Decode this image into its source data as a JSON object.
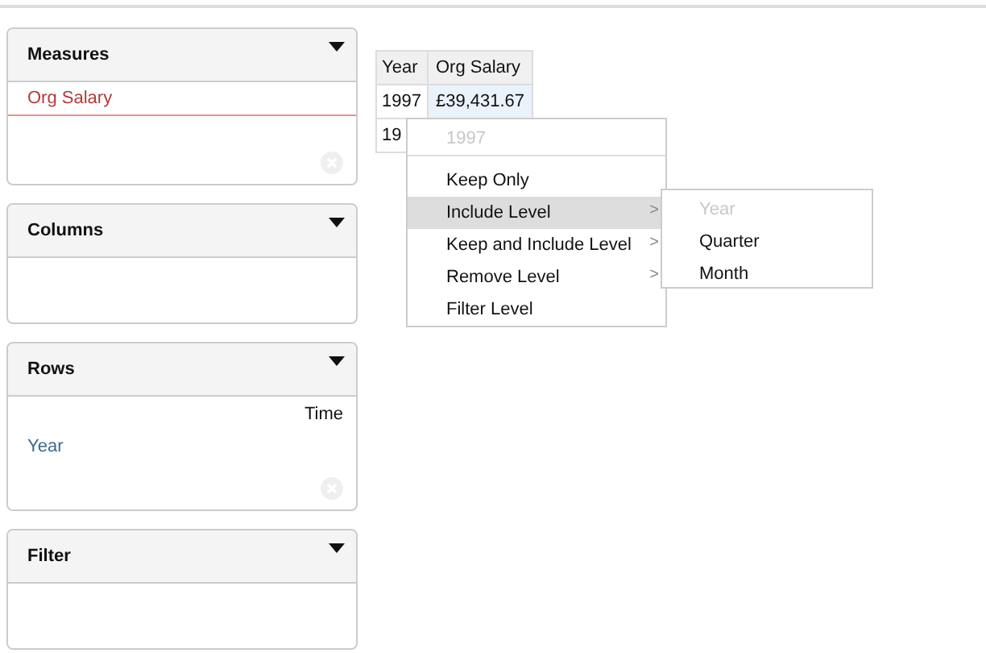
{
  "panels": [
    {
      "title": "Measures",
      "kind": "measures",
      "items": [
        {
          "label": "Org Salary"
        }
      ],
      "clear_button": true
    },
    {
      "title": "Columns",
      "kind": "plain",
      "clear_button": false
    },
    {
      "title": "Rows",
      "kind": "rows",
      "dimension": "Time",
      "items": [
        {
          "label": "Year"
        }
      ],
      "clear_button": true
    },
    {
      "title": "Filter",
      "kind": "plain",
      "clear_button": false
    }
  ],
  "table": {
    "columns": [
      "Year",
      "Org Salary"
    ],
    "rows": [
      [
        "1997",
        "£39,431.67"
      ],
      [
        "19"
      ]
    ]
  },
  "context_menu": {
    "header": "1997",
    "items": [
      {
        "label": "Keep Only",
        "selected": false
      },
      {
        "label": "Include Level",
        "arrow": ">",
        "selected": true
      },
      {
        "label": "Keep and Include Level",
        "arrow": ">",
        "selected": false
      },
      {
        "label": "Remove Level",
        "arrow": ">",
        "selected": false
      },
      {
        "label": "Filter Level",
        "selected": false
      }
    ]
  },
  "submenu": {
    "items": [
      {
        "label": "Year",
        "disabled": true
      },
      {
        "label": "Quarter",
        "disabled": false
      },
      {
        "label": "Month",
        "disabled": false
      }
    ]
  }
}
